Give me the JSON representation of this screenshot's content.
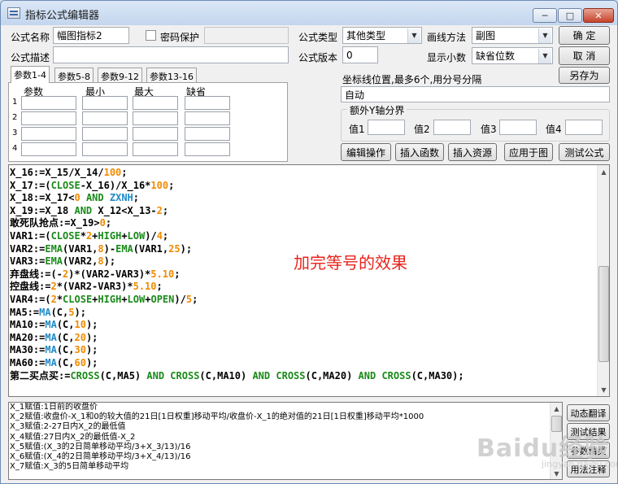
{
  "window": {
    "title": "指标公式编辑器"
  },
  "form": {
    "name_label": "公式名称",
    "name_value": "幅图指标2",
    "password_label": "密码保护",
    "password_value": "",
    "type_label": "公式类型",
    "type_value": "其他类型",
    "draw_label": "画线方法",
    "draw_value": "副图",
    "desc_label": "公式描述",
    "desc_value": "",
    "version_label": "公式版本",
    "version_value": "0",
    "decimals_label": "显示小数",
    "decimals_value": "缺省位数"
  },
  "buttons": {
    "ok": "确  定",
    "cancel": "取  消",
    "save_as": "另存为",
    "edit_op": "编辑操作",
    "insert_func": "插入函数",
    "insert_res": "插入资源",
    "apply": "应用于图",
    "test": "测试公式",
    "dyn_translate": "动态翻译",
    "test_result": "测试结果",
    "param_wizard": "参数精灵",
    "usage_note": "用法注释"
  },
  "params": {
    "tabs": [
      "参数1-4",
      "参数5-8",
      "参数9-12",
      "参数13-16"
    ],
    "headers": [
      "参数",
      "最小",
      "最大",
      "缺省"
    ],
    "rows": [
      "1",
      "2",
      "3",
      "4"
    ]
  },
  "axis": {
    "label": "坐标线位置,最多6个,用分号分隔",
    "value": "自动",
    "group_label": "额外Y轴分界",
    "value_labels": [
      "值1",
      "值2",
      "值3",
      "值4"
    ]
  },
  "editor": {
    "lines": [
      [
        {
          "t": "X_16:=X_15/X_14/"
        },
        {
          "t": "100",
          "c": "num"
        },
        {
          "t": ";"
        }
      ],
      [
        {
          "t": "X_17:=("
        },
        {
          "t": "CLOSE",
          "c": "kw"
        },
        {
          "t": "-X_16)/X_16*"
        },
        {
          "t": "100",
          "c": "num"
        },
        {
          "t": ";"
        }
      ],
      [
        {
          "t": "X_18:=X_17<"
        },
        {
          "t": "0",
          "c": "num"
        },
        {
          "t": " "
        },
        {
          "t": "AND",
          "c": "kw"
        },
        {
          "t": " "
        },
        {
          "t": "ZXNH",
          "c": "fn"
        },
        {
          "t": ";"
        }
      ],
      [
        {
          "t": "X_19:=X_18 "
        },
        {
          "t": "AND",
          "c": "kw"
        },
        {
          "t": " X_12<X_13-"
        },
        {
          "t": "2",
          "c": "num"
        },
        {
          "t": ";"
        }
      ],
      [
        {
          "t": "敢死队抢点:=X_19>"
        },
        {
          "t": "0",
          "c": "num"
        },
        {
          "t": ";"
        }
      ],
      [
        {
          "t": "VAR1:=("
        },
        {
          "t": "CLOSE",
          "c": "kw"
        },
        {
          "t": "*"
        },
        {
          "t": "2",
          "c": "num"
        },
        {
          "t": "+"
        },
        {
          "t": "HIGH",
          "c": "kw"
        },
        {
          "t": "+"
        },
        {
          "t": "LOW",
          "c": "kw"
        },
        {
          "t": ")/"
        },
        {
          "t": "4",
          "c": "num"
        },
        {
          "t": ";"
        }
      ],
      [
        {
          "t": "VAR2:="
        },
        {
          "t": "EMA",
          "c": "kw"
        },
        {
          "t": "(VAR1,"
        },
        {
          "t": "8",
          "c": "num"
        },
        {
          "t": ")-"
        },
        {
          "t": "EMA",
          "c": "kw"
        },
        {
          "t": "(VAR1,"
        },
        {
          "t": "25",
          "c": "num"
        },
        {
          "t": ");"
        }
      ],
      [
        {
          "t": "VAR3:="
        },
        {
          "t": "EMA",
          "c": "kw"
        },
        {
          "t": "(VAR2,"
        },
        {
          "t": "8",
          "c": "num"
        },
        {
          "t": ");"
        }
      ],
      [
        {
          "t": "弃盘线:=(-"
        },
        {
          "t": "2",
          "c": "num"
        },
        {
          "t": ")*(VAR2-VAR3)*"
        },
        {
          "t": "5.10",
          "c": "num"
        },
        {
          "t": ";"
        }
      ],
      [
        {
          "t": "控盘线:="
        },
        {
          "t": "2",
          "c": "num"
        },
        {
          "t": "*(VAR2-VAR3)*"
        },
        {
          "t": "5.10",
          "c": "num"
        },
        {
          "t": ";"
        }
      ],
      [
        {
          "t": "VAR4:=("
        },
        {
          "t": "2",
          "c": "num"
        },
        {
          "t": "*"
        },
        {
          "t": "CLOSE",
          "c": "kw"
        },
        {
          "t": "+"
        },
        {
          "t": "HIGH",
          "c": "kw"
        },
        {
          "t": "+"
        },
        {
          "t": "LOW",
          "c": "kw"
        },
        {
          "t": "+"
        },
        {
          "t": "OPEN",
          "c": "kw"
        },
        {
          "t": ")/"
        },
        {
          "t": "5",
          "c": "num"
        },
        {
          "t": ";"
        }
      ],
      [
        {
          "t": "MA5:="
        },
        {
          "t": "MA",
          "c": "fn"
        },
        {
          "t": "(C,"
        },
        {
          "t": "5",
          "c": "num"
        },
        {
          "t": ");"
        }
      ],
      [
        {
          "t": "MA10:="
        },
        {
          "t": "MA",
          "c": "fn"
        },
        {
          "t": "(C,"
        },
        {
          "t": "10",
          "c": "num"
        },
        {
          "t": ");"
        }
      ],
      [
        {
          "t": "MA20:="
        },
        {
          "t": "MA",
          "c": "fn"
        },
        {
          "t": "(C,"
        },
        {
          "t": "20",
          "c": "num"
        },
        {
          "t": ");"
        }
      ],
      [
        {
          "t": "MA30:="
        },
        {
          "t": "MA",
          "c": "fn"
        },
        {
          "t": "(C,"
        },
        {
          "t": "30",
          "c": "num"
        },
        {
          "t": ");"
        }
      ],
      [
        {
          "t": "MA60:="
        },
        {
          "t": "MA",
          "c": "fn"
        },
        {
          "t": "(C,"
        },
        {
          "t": "60",
          "c": "num"
        },
        {
          "t": ");"
        }
      ],
      [
        {
          "t": "第二买点买:="
        },
        {
          "t": "CROSS",
          "c": "kw"
        },
        {
          "t": "(C,MA5) "
        },
        {
          "t": "AND",
          "c": "kw"
        },
        {
          "t": " "
        },
        {
          "t": "CROSS",
          "c": "kw"
        },
        {
          "t": "(C,MA10) "
        },
        {
          "t": "AND",
          "c": "kw"
        },
        {
          "t": " "
        },
        {
          "t": "CROSS",
          "c": "kw"
        },
        {
          "t": "(C,MA20) "
        },
        {
          "t": "AND",
          "c": "kw"
        },
        {
          "t": " "
        },
        {
          "t": "CROSS",
          "c": "kw"
        },
        {
          "t": "(C,MA30);"
        }
      ]
    ],
    "annotation": "加完等号的效果"
  },
  "output": {
    "lines": [
      "X_1赋值:1日前的收盘价",
      "X_2赋值:收盘价-X_1和0的较大值的21日[1日权重]移动平均/收盘价-X_1的绝对值的21日[1日权重]移动平均*1000",
      "X_3赋值:2-27日内X_2的最低值",
      "X_4赋值:27日内X_2的最低值-X_2",
      "X_5赋值:(X_3的2日简单移动平均/3+X_3/13)/16",
      "X_6赋值:(X_4的2日简单移动平均/3+X_4/13)/16",
      "X_7赋值:X_3的5日简单移动平均"
    ]
  },
  "watermark": {
    "logo": "Baidu经验",
    "sub": "jingyan.baidu.com"
  }
}
